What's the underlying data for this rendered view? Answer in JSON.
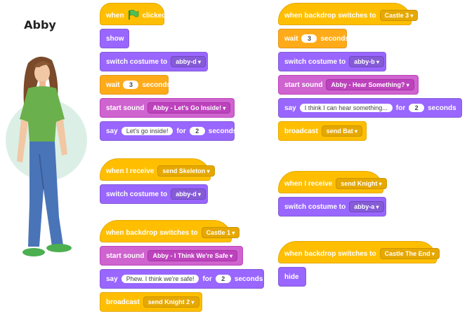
{
  "sprite": {
    "name": "Abby"
  },
  "colors": {
    "events": "#ffbf00",
    "looks": "#9966ff",
    "sound": "#cf63cf",
    "control": "#ffab19"
  },
  "scripts": {
    "s1": {
      "hat": {
        "pre": "when",
        "post": "clicked",
        "icon": "green-flag-icon"
      },
      "show": "show",
      "costume1": {
        "label": "switch costume to",
        "value": "abby-d"
      },
      "wait": {
        "label": "wait",
        "value": "3",
        "unit": "seconds"
      },
      "sound": {
        "label": "start sound",
        "value": "Abby - Let's Go Inside!"
      },
      "say": {
        "label": "say",
        "text": "Let's go inside!",
        "for": "for",
        "secs": "2",
        "unit": "seconds"
      }
    },
    "s2": {
      "hat": {
        "label": "when I receive",
        "value": "send Skeleton"
      },
      "costume": {
        "label": "switch costume to",
        "value": "abby-d"
      }
    },
    "s3": {
      "hat": {
        "label": "when backdrop switches to",
        "value": "Castle 1"
      },
      "sound": {
        "label": "start sound",
        "value": "Abby - I Think We're Safe"
      },
      "say": {
        "label": "say",
        "text": "Phew. I think we're safe!",
        "for": "for",
        "secs": "2",
        "unit": "seconds"
      },
      "broadcast": {
        "label": "broadcast",
        "value": "send Knight 2"
      }
    },
    "s4": {
      "hat": {
        "label": "when backdrop switches to",
        "value": "Castle 3"
      },
      "wait": {
        "label": "wait",
        "value": "3",
        "unit": "seconds"
      },
      "costume": {
        "label": "switch costume to",
        "value": "abby-b"
      },
      "sound": {
        "label": "start sound",
        "value": "Abby - Hear Something?"
      },
      "say": {
        "label": "say",
        "text": "I think I can hear something...",
        "for": "for",
        "secs": "2",
        "unit": "seconds"
      },
      "broadcast": {
        "label": "broadcast",
        "value": "send Bat"
      }
    },
    "s5": {
      "hat": {
        "label": "when I receive",
        "value": "send Knight"
      },
      "costume": {
        "label": "switch costume to",
        "value": "abby-a"
      }
    },
    "s6": {
      "hat": {
        "label": "when backdrop switches to",
        "value": "Castle The End"
      },
      "hide": "hide"
    }
  }
}
